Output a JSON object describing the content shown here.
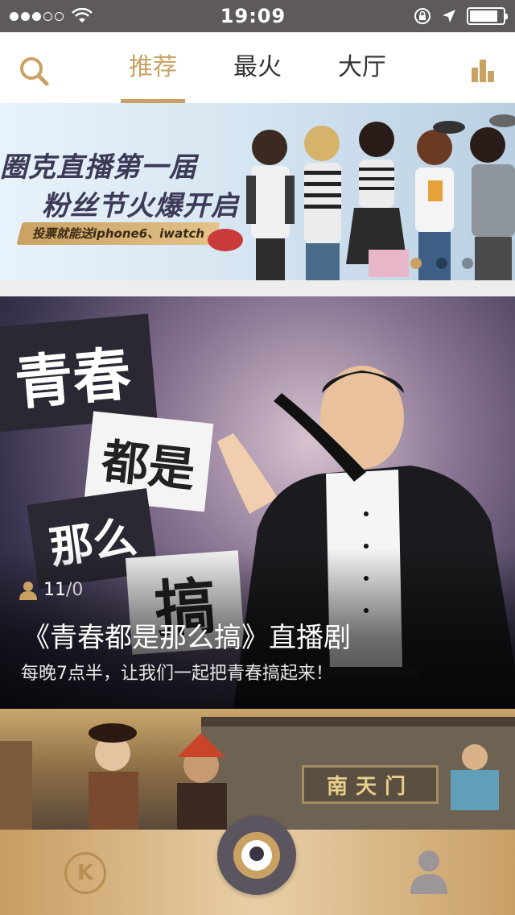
{
  "status_bar": {
    "time": "19:09",
    "battery_level": 0.85
  },
  "nav": {
    "tabs": [
      {
        "label": "推荐",
        "active": true
      },
      {
        "label": "最火",
        "active": false
      },
      {
        "label": "大厅",
        "active": false
      }
    ],
    "accent_color": "#c9a163"
  },
  "banner": {
    "title_line1": "圈克直播第一届",
    "title_line2": "粉丝节火爆开启",
    "promo": "投票就能送iphone6、iwatch",
    "page_count": 3,
    "active_page": 1
  },
  "feature": {
    "poster_text": {
      "block1": "青春",
      "block2": "都是",
      "block3": "那么",
      "block4": "搞"
    },
    "viewers": "11",
    "viewer_sep": "/",
    "viewer_total": "0",
    "title": "《青春都是那么搞》直播剧",
    "subtitle": "每晚7点半，让我们一起把青春搞起来！"
  },
  "card2": {
    "sign_text": "南天门"
  },
  "tabbar": {
    "home_glyph": "K",
    "icons": [
      "home-icon",
      "live-camera-icon",
      "profile-icon"
    ]
  }
}
